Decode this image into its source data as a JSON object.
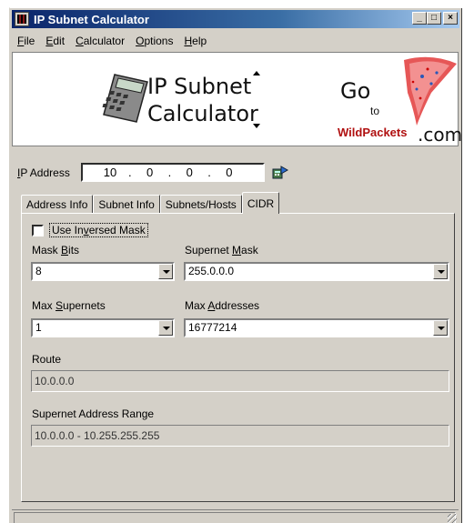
{
  "window": {
    "title": "IP Subnet Calculator"
  },
  "menu": [
    {
      "pre": "",
      "key": "F",
      "post": "ile"
    },
    {
      "pre": "",
      "key": "E",
      "post": "dit"
    },
    {
      "pre": "",
      "key": "C",
      "post": "alculator"
    },
    {
      "pre": "",
      "key": "O",
      "post": "ptions"
    },
    {
      "pre": "",
      "key": "H",
      "post": "elp"
    }
  ],
  "banner": {
    "title_line1": "IP Subnet",
    "title_line2": "Calculator",
    "ad_go": "Go",
    "ad_to": "to",
    "ad_brand": "WildPackets",
    "ad_com": ".com"
  },
  "ip": {
    "label_key": "I",
    "label_rest": "P Address",
    "octets": [
      "10",
      "0",
      "0",
      "0"
    ]
  },
  "tabs": [
    "Address Info",
    "Subnet Info",
    "Subnets/Hosts",
    "CIDR"
  ],
  "active_tab": "CIDR",
  "cidr": {
    "inverse_mask_pre": "Use In",
    "inverse_mask_key": "v",
    "inverse_mask_post": "ersed Mask",
    "inverse_mask_checked": false,
    "mask_bits_pre": "Mask ",
    "mask_bits_key": "B",
    "mask_bits_post": "its",
    "mask_bits_value": "8",
    "supernet_mask_pre": "Supernet ",
    "supernet_mask_key": "M",
    "supernet_mask_post": "ask",
    "supernet_mask_value": "255.0.0.0",
    "max_supernets_pre": "Max ",
    "max_supernets_key": "S",
    "max_supernets_post": "upernets",
    "max_supernets_value": "1",
    "max_addresses_pre": "Max ",
    "max_addresses_key": "A",
    "max_addresses_post": "ddresses",
    "max_addresses_value": "16777214",
    "route_label": "Route",
    "route_value": "10.0.0.0",
    "range_label": "Supernet Address Range",
    "range_value": "10.0.0.0 - 10.255.255.255"
  },
  "colors": {
    "face": "#d4d0c8",
    "title_start": "#0a246a",
    "title_end": "#a6caf0",
    "brand": "#b01010"
  }
}
